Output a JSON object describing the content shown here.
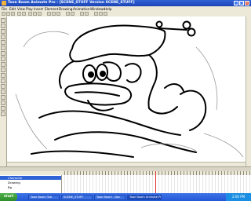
{
  "window": {
    "title": "Toon Boom Animate Pro - [SCENE_STUFF Version SCENE_STUFF]"
  },
  "menu": [
    "File",
    "Edit",
    "View",
    "Play",
    "Insert",
    "Element",
    "Drawing",
    "Animation",
    "Windows",
    "Help"
  ],
  "timeline": {
    "layers": [
      {
        "label": "Character",
        "selected": true
      },
      {
        "label": "Drawing",
        "selected": false
      },
      {
        "label": "Bg",
        "selected": false
      }
    ],
    "current_frame": 16
  },
  "taskbar": {
    "start_label": "start",
    "tasks": [
      {
        "label": "Toon Boom Tab",
        "active": false
      },
      {
        "label": "SCENE_STUFF",
        "active": false
      },
      {
        "label": "Toon Boom - Doc",
        "active": false
      },
      {
        "label": "Toon Boom Animate Pro",
        "active": true
      }
    ],
    "clock": "2:00 PM"
  },
  "colors": {
    "titlebar": "#1c44b5",
    "chrome": "#ece9d8",
    "playhead": "#e0302b",
    "taskbar": "#2459d6"
  }
}
